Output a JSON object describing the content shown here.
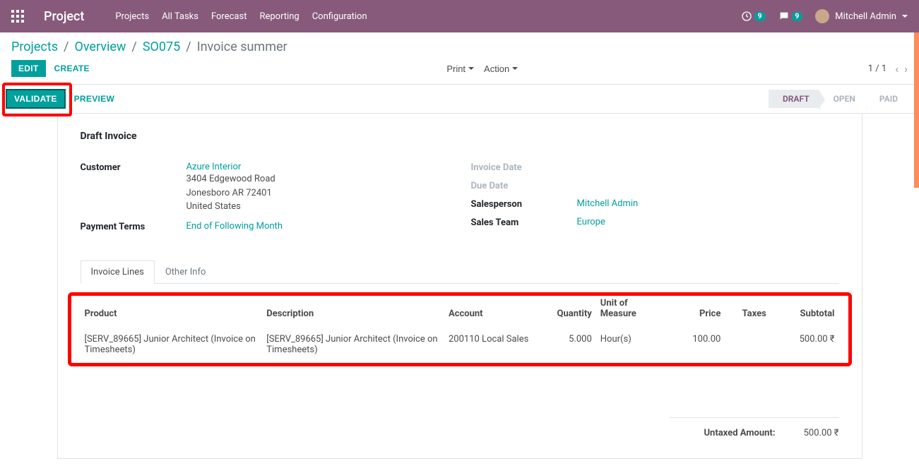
{
  "nav": {
    "brand": "Project",
    "menu": [
      "Projects",
      "All Tasks",
      "Forecast",
      "Reporting",
      "Configuration"
    ],
    "badge1": "9",
    "badge2": "9",
    "user": "Mitchell Admin"
  },
  "breadcrumb": {
    "items": [
      "Projects",
      "Overview",
      "SO075"
    ],
    "current": "Invoice summer"
  },
  "buttons": {
    "edit": "EDIT",
    "create": "CREATE",
    "print": "Print",
    "action": "Action",
    "validate": "VALIDATE",
    "preview": "PREVIEW"
  },
  "pager": {
    "current": "1 / 1"
  },
  "status": {
    "draft": "DRAFT",
    "open": "OPEN",
    "paid": "PAID"
  },
  "form": {
    "title": "Draft Invoice",
    "labels": {
      "customer": "Customer",
      "payment_terms": "Payment Terms",
      "invoice_date": "Invoice Date",
      "due_date": "Due Date",
      "salesperson": "Salesperson",
      "sales_team": "Sales Team"
    },
    "customer_name": "Azure Interior",
    "customer_addr": [
      "3404 Edgewood Road",
      "Jonesboro AR 72401",
      "United States"
    ],
    "payment_terms": "End of Following Month",
    "salesperson": "Mitchell Admin",
    "sales_team": "Europe"
  },
  "tabs": {
    "lines": "Invoice Lines",
    "other": "Other Info"
  },
  "table": {
    "headers": {
      "product": "Product",
      "description": "Description",
      "account": "Account",
      "quantity": "Quantity",
      "uom": "Unit of Measure",
      "price": "Price",
      "taxes": "Taxes",
      "subtotal": "Subtotal"
    },
    "rows": [
      {
        "product": "[SERV_89665] Junior Architect (Invoice on Timesheets)",
        "description": "[SERV_89665] Junior Architect (Invoice on Timesheets)",
        "account": "200110 Local Sales",
        "quantity": "5.000",
        "uom": "Hour(s)",
        "price": "100.00",
        "taxes": "",
        "subtotal": "500.00 ₹"
      }
    ]
  },
  "totals": {
    "untaxed_label": "Untaxed Amount:",
    "untaxed_value": "500.00 ₹"
  }
}
